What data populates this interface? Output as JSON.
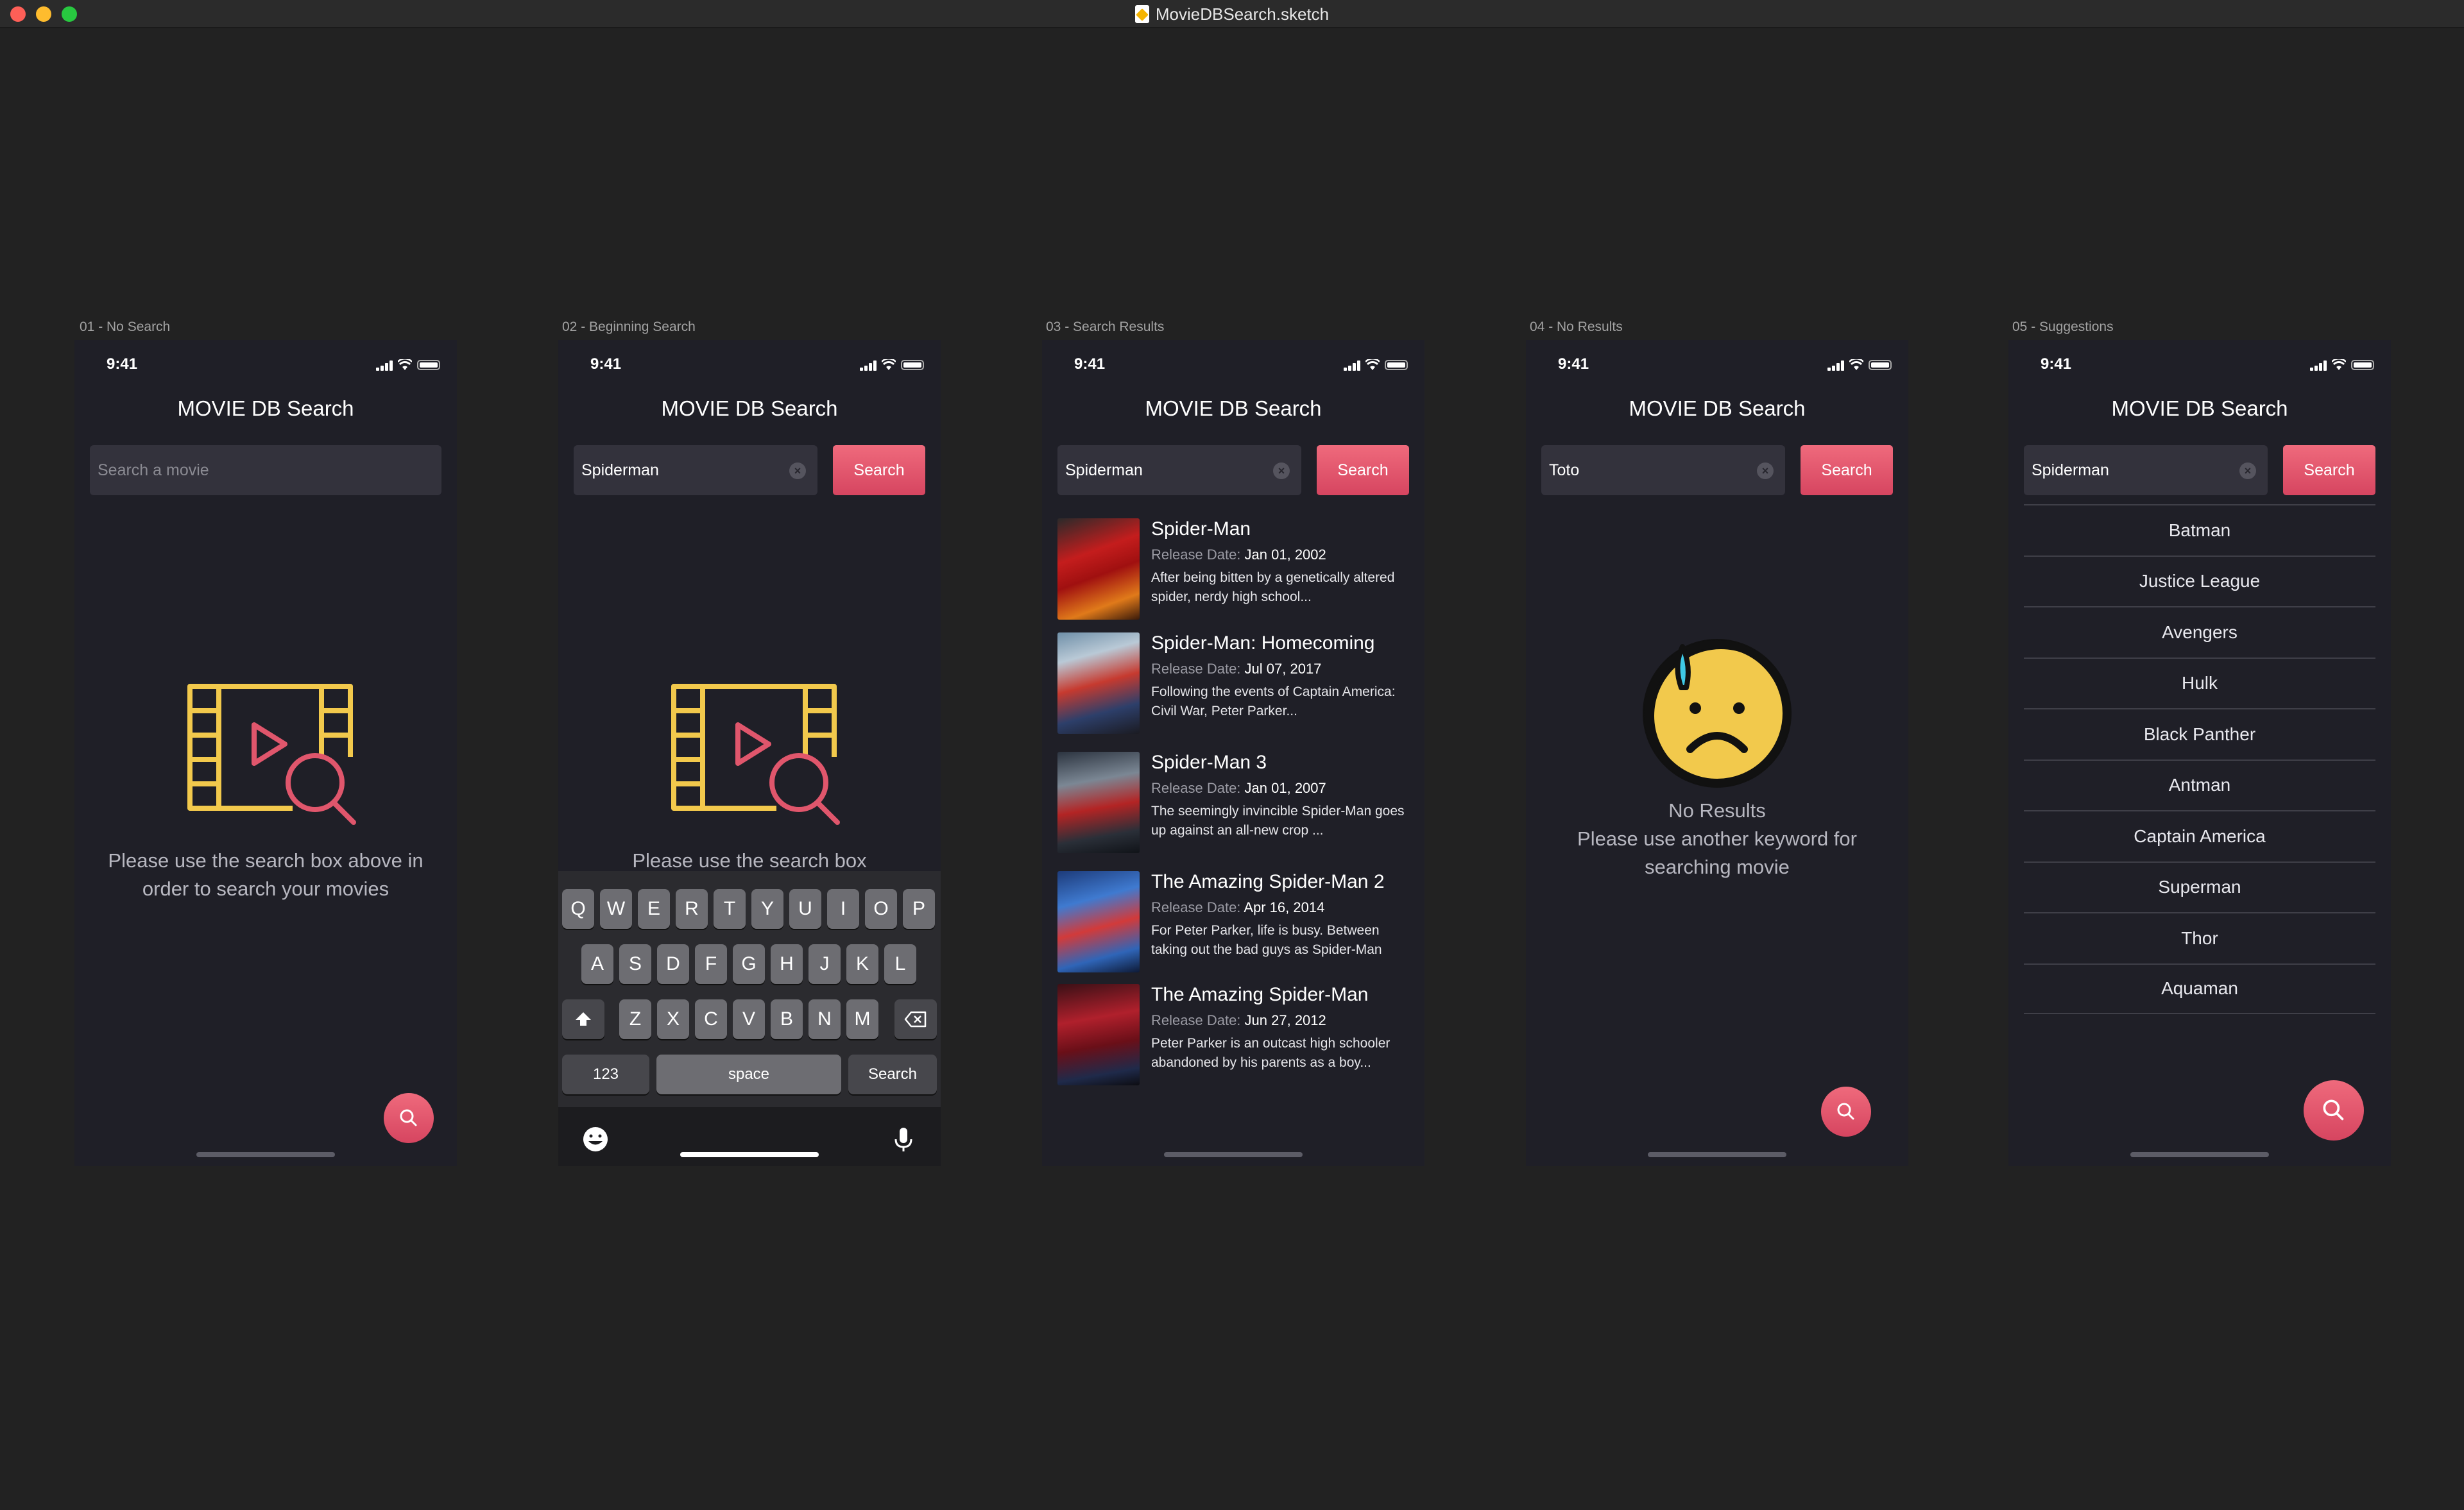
{
  "window": {
    "title": "MovieDBSearch.sketch"
  },
  "colors": {
    "accent": "#e0566c",
    "yellow": "#f2c94c",
    "background": "#1f1f27"
  },
  "common": {
    "time": "9:41",
    "app_title": "MOVIE DB Search",
    "search_button": "Search"
  },
  "screen1": {
    "label": "01 - No Search",
    "placeholder": "Search a movie",
    "hint": "Please use the search box above in order to search your movies"
  },
  "screen2": {
    "label": "02 - Beginning Search",
    "query": "Spiderman",
    "hint_partial": "Please use the search box",
    "keyboard": {
      "row1": [
        "Q",
        "W",
        "E",
        "R",
        "T",
        "Y",
        "U",
        "I",
        "O",
        "P"
      ],
      "row2": [
        "A",
        "S",
        "D",
        "F",
        "G",
        "H",
        "J",
        "K",
        "L"
      ],
      "row3": [
        "Z",
        "X",
        "C",
        "V",
        "B",
        "N",
        "M"
      ],
      "numbers_key": "123",
      "space_key": "space",
      "return_key": "Search"
    }
  },
  "screen3": {
    "label": "03 - Search Results",
    "query": "Spiderman",
    "release_label": "Release Date:",
    "results": [
      {
        "title": "Spider-Man",
        "date": "Jan 01, 2002",
        "desc": "After being bitten by a genetically altered spider, nerdy high school..."
      },
      {
        "title": "Spider-Man: Homecoming",
        "date": "Jul 07, 2017",
        "desc": "Following the events of Captain America: Civil War, Peter Parker..."
      },
      {
        "title": "Spider-Man 3",
        "date": "Jan 01, 2007",
        "desc": "The seemingly invincible Spider-Man goes up against an all-new crop ..."
      },
      {
        "title": "The Amazing Spider-Man 2",
        "date": "Apr 16, 2014",
        "desc": "For Peter Parker, life is busy. Between taking out the bad guys as Spider-Man"
      },
      {
        "title": "The Amazing Spider-Man",
        "date": "Jun 27, 2012",
        "desc": "Peter Parker is an outcast high schooler abandoned by his parents as a boy..."
      }
    ]
  },
  "screen4": {
    "label": "04 - No Results",
    "query": "Toto",
    "title": "No Results",
    "message": "Please use another keyword for searching movie"
  },
  "screen5": {
    "label": "05 - Suggestions",
    "query": "Spiderman",
    "suggestions": [
      "Batman",
      "Justice League",
      "Avengers",
      "Hulk",
      "Black Panther",
      "Antman",
      "Captain America",
      "Superman",
      "Thor",
      "Aquaman"
    ]
  }
}
